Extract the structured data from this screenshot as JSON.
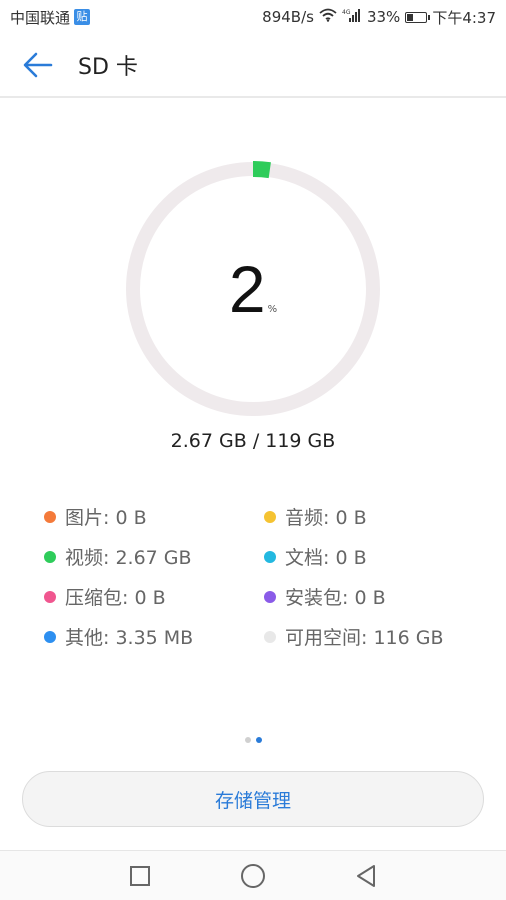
{
  "status_bar": {
    "carrier": "中国联通",
    "carrier_badge": "贴",
    "network_speed": "894B/s",
    "signal_label": "4G",
    "battery_percent": "33%",
    "battery_level": 0.33,
    "time": "下午4:37"
  },
  "app_bar": {
    "back_icon": "arrow-left-icon",
    "title": "SD 卡"
  },
  "ring": {
    "percent": "2",
    "percent_sign": "%",
    "used_fraction": 0.0224,
    "track_color": "#efeaec",
    "used_color": "#2ecc5a"
  },
  "usage_text": "2.67 GB / 119 GB",
  "legend": [
    {
      "label": "图片: 0 B",
      "color": "#f47a3a"
    },
    {
      "label": "音频: 0 B",
      "color": "#f5c332"
    },
    {
      "label": "视频: 2.67 GB",
      "color": "#2ecc5a"
    },
    {
      "label": "文档: 0 B",
      "color": "#23b8e0"
    },
    {
      "label": "压缩包: 0 B",
      "color": "#f0568f"
    },
    {
      "label": "安装包: 0 B",
      "color": "#8a5be8"
    },
    {
      "label": "其他: 3.35 MB",
      "color": "#2d8ff0"
    },
    {
      "label": "可用空间: 116 GB",
      "color": "#e8e8e8"
    }
  ],
  "page_dots": {
    "count": 2,
    "active_index": 1,
    "active_color": "#2a7bd8",
    "inactive_color": "#d0d0d0"
  },
  "storage_button": {
    "label": "存储管理"
  },
  "nav_bar": {
    "recents_icon": "square-icon",
    "home_icon": "circle-icon",
    "back_icon": "triangle-back-icon"
  }
}
